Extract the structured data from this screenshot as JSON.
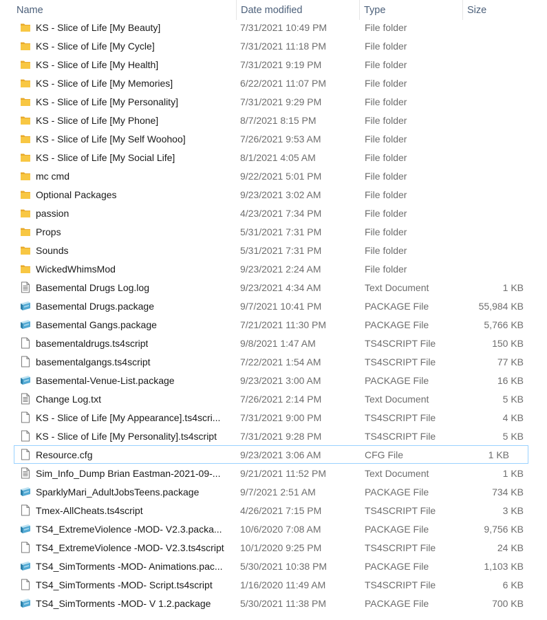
{
  "columns": {
    "name": "Name",
    "date": "Date modified",
    "type": "Type",
    "size": "Size"
  },
  "sort_indicator": "^",
  "files": [
    {
      "name": "KS - Slice of Life [My Beauty]",
      "date": "7/31/2021 10:49 PM",
      "type": "File folder",
      "size": "",
      "icon": "folder-icon"
    },
    {
      "name": "KS - Slice of Life [My Cycle]",
      "date": "7/31/2021 11:18 PM",
      "type": "File folder",
      "size": "",
      "icon": "folder-icon"
    },
    {
      "name": "KS - Slice of Life [My Health]",
      "date": "7/31/2021 9:19 PM",
      "type": "File folder",
      "size": "",
      "icon": "folder-icon"
    },
    {
      "name": "KS - Slice of Life [My Memories]",
      "date": "6/22/2021 11:07 PM",
      "type": "File folder",
      "size": "",
      "icon": "folder-icon"
    },
    {
      "name": "KS - Slice of Life [My Personality]",
      "date": "7/31/2021 9:29 PM",
      "type": "File folder",
      "size": "",
      "icon": "folder-icon"
    },
    {
      "name": "KS - Slice of Life [My Phone]",
      "date": "8/7/2021 8:15 PM",
      "type": "File folder",
      "size": "",
      "icon": "folder-icon"
    },
    {
      "name": "KS - Slice of Life [My Self Woohoo]",
      "date": "7/26/2021 9:53 AM",
      "type": "File folder",
      "size": "",
      "icon": "folder-icon"
    },
    {
      "name": "KS - Slice of Life [My Social Life]",
      "date": "8/1/2021 4:05 AM",
      "type": "File folder",
      "size": "",
      "icon": "folder-icon"
    },
    {
      "name": "mc cmd",
      "date": "9/22/2021 5:01 PM",
      "type": "File folder",
      "size": "",
      "icon": "folder-icon"
    },
    {
      "name": "Optional Packages",
      "date": "9/23/2021 3:02 AM",
      "type": "File folder",
      "size": "",
      "icon": "folder-icon"
    },
    {
      "name": "passion",
      "date": "4/23/2021 7:34 PM",
      "type": "File folder",
      "size": "",
      "icon": "folder-icon"
    },
    {
      "name": "Props",
      "date": "5/31/2021 7:31 PM",
      "type": "File folder",
      "size": "",
      "icon": "folder-icon"
    },
    {
      "name": "Sounds",
      "date": "5/31/2021 7:31 PM",
      "type": "File folder",
      "size": "",
      "icon": "folder-icon"
    },
    {
      "name": "WickedWhimsMod",
      "date": "9/23/2021 2:24 AM",
      "type": "File folder",
      "size": "",
      "icon": "folder-icon"
    },
    {
      "name": "Basemental Drugs Log.log",
      "date": "9/23/2021 4:34 AM",
      "type": "Text Document",
      "size": "1 KB",
      "icon": "text-document-icon"
    },
    {
      "name": "Basemental Drugs.package",
      "date": "9/7/2021 10:41 PM",
      "type": "PACKAGE File",
      "size": "55,984 KB",
      "icon": "package-file-icon"
    },
    {
      "name": "Basemental Gangs.package",
      "date": "7/21/2021 11:30 PM",
      "type": "PACKAGE File",
      "size": "5,766 KB",
      "icon": "package-file-icon"
    },
    {
      "name": "basementaldrugs.ts4script",
      "date": "9/8/2021 1:47 AM",
      "type": "TS4SCRIPT File",
      "size": "150 KB",
      "icon": "blank-file-icon"
    },
    {
      "name": "basementalgangs.ts4script",
      "date": "7/22/2021 1:54 AM",
      "type": "TS4SCRIPT File",
      "size": "77 KB",
      "icon": "blank-file-icon"
    },
    {
      "name": "Basemental-Venue-List.package",
      "date": "9/23/2021 3:00 AM",
      "type": "PACKAGE File",
      "size": "16 KB",
      "icon": "package-file-icon"
    },
    {
      "name": "Change Log.txt",
      "date": "7/26/2021 2:14 PM",
      "type": "Text Document",
      "size": "5 KB",
      "icon": "text-document-icon"
    },
    {
      "name": "KS - Slice of Life [My Appearance].ts4scri...",
      "date": "7/31/2021 9:00 PM",
      "type": "TS4SCRIPT File",
      "size": "4 KB",
      "icon": "blank-file-icon"
    },
    {
      "name": "KS - Slice of Life [My Personality].ts4script",
      "date": "7/31/2021 9:28 PM",
      "type": "TS4SCRIPT File",
      "size": "5 KB",
      "icon": "blank-file-icon"
    },
    {
      "name": "Resource.cfg",
      "date": "9/23/2021 3:06 AM",
      "type": "CFG File",
      "size": "1 KB",
      "icon": "blank-file-icon",
      "focused": true
    },
    {
      "name": "Sim_Info_Dump Brian Eastman-2021-09-...",
      "date": "9/21/2021 11:52 PM",
      "type": "Text Document",
      "size": "1 KB",
      "icon": "text-document-icon"
    },
    {
      "name": "SparklyMari_AdultJobsTeens.package",
      "date": "9/7/2021 2:51 AM",
      "type": "PACKAGE File",
      "size": "734 KB",
      "icon": "package-file-icon"
    },
    {
      "name": "Tmex-AllCheats.ts4script",
      "date": "4/26/2021 7:15 PM",
      "type": "TS4SCRIPT File",
      "size": "3 KB",
      "icon": "blank-file-icon"
    },
    {
      "name": "TS4_ExtremeViolence -MOD- V2.3.packa...",
      "date": "10/6/2020 7:08 AM",
      "type": "PACKAGE File",
      "size": "9,756 KB",
      "icon": "package-file-icon"
    },
    {
      "name": "TS4_ExtremeViolence -MOD- V2.3.ts4script",
      "date": "10/1/2020 9:25 PM",
      "type": "TS4SCRIPT File",
      "size": "24 KB",
      "icon": "blank-file-icon"
    },
    {
      "name": "TS4_SimTorments -MOD- Animations.pac...",
      "date": "5/30/2021 10:38 PM",
      "type": "PACKAGE File",
      "size": "1,103 KB",
      "icon": "package-file-icon"
    },
    {
      "name": "TS4_SimTorments -MOD- Script.ts4script",
      "date": "1/16/2020 11:49 AM",
      "type": "TS4SCRIPT File",
      "size": "6 KB",
      "icon": "blank-file-icon"
    },
    {
      "name": "TS4_SimTorments -MOD- V 1.2.package",
      "date": "5/30/2021 11:38 PM",
      "type": "PACKAGE File",
      "size": "700 KB",
      "icon": "package-file-icon"
    }
  ],
  "colors": {
    "header_text": "#4c607a",
    "secondary_text": "#6d6d6d",
    "folder": "#f8c743",
    "focus_border": "#99d1ff"
  }
}
